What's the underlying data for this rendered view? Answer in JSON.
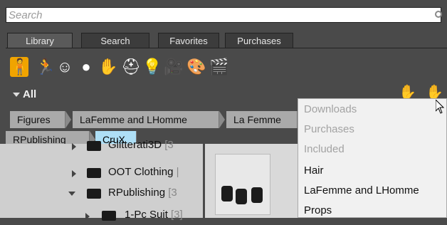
{
  "search": {
    "placeholder": "Search"
  },
  "tabs": [
    "Library",
    "Search",
    "Favorites",
    "Purchases"
  ],
  "icons": [
    "figure-icon",
    "pose-icon",
    "expression-icon",
    "hair-icon",
    "gloves-icon",
    "hat-icon",
    "light-icon",
    "camera-icon",
    "materials-icon",
    "scene-icon"
  ],
  "filter": {
    "label": "All"
  },
  "breadcrumbs": [
    "Figures",
    "LaFemme and LHomme",
    "La Femme",
    "RPublishing",
    "CruX"
  ],
  "tree": [
    {
      "label": "Glitterati3D",
      "count": "[3"
    },
    {
      "label": "OOT Clothing",
      "count": "|"
    },
    {
      "label": "RPublishing",
      "count": "[3"
    },
    {
      "label": "1-Pc Suit",
      "count": "[3]"
    }
  ],
  "dropdown": {
    "items": [
      {
        "label": "Downloads",
        "enabled": false
      },
      {
        "label": "Purchases",
        "enabled": false
      },
      {
        "label": "Included",
        "enabled": false
      },
      {
        "label": "Hair",
        "enabled": true
      },
      {
        "label": "LaFemme and LHomme",
        "enabled": true
      },
      {
        "label": "Props",
        "enabled": true
      }
    ]
  },
  "colors": {
    "accent": "#f0a400",
    "selected_crumb": "#aedff6",
    "panel": "#4a4a4a"
  }
}
